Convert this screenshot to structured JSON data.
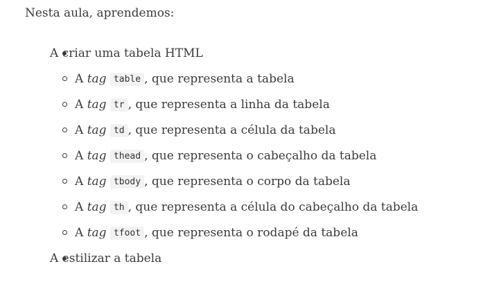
{
  "intro": "Nesta aula, aprendemos:",
  "list": [
    {
      "text": "A criar uma tabela HTML",
      "subitems": [
        {
          "prefix": "A",
          "tag_word": "tag",
          "code": "table",
          "suffix": ", que representa a tabela"
        },
        {
          "prefix": "A",
          "tag_word": "tag",
          "code": "tr",
          "suffix": ", que representa a linha da tabela"
        },
        {
          "prefix": "A",
          "tag_word": "tag",
          "code": "td",
          "suffix": ", que representa a célula da tabela"
        },
        {
          "prefix": "A",
          "tag_word": "tag",
          "code": "thead",
          "suffix": ", que representa o cabeçalho da tabela"
        },
        {
          "prefix": "A",
          "tag_word": "tag",
          "code": "tbody",
          "suffix": ", que representa o corpo da tabela"
        },
        {
          "prefix": "A",
          "tag_word": "tag",
          "code": "th",
          "suffix": ", que representa a célula do cabeçalho da tabela"
        },
        {
          "prefix": "A",
          "tag_word": "tag",
          "code": "tfoot",
          "suffix": ", que representa o rodapé da tabela"
        }
      ]
    },
    {
      "text": "A estilizar a tabela"
    }
  ]
}
